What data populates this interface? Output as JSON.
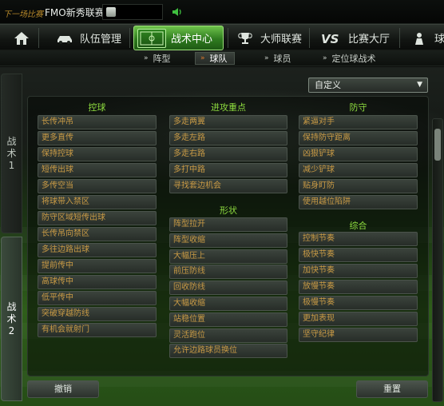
{
  "topbar": {
    "next_match": "下一场比赛",
    "league_name": "FMO新秀联赛"
  },
  "main_nav": [
    {
      "label": "",
      "icon": "home-icon"
    },
    {
      "label": "队伍管理",
      "icon": "car-icon"
    },
    {
      "label": "战术中心",
      "icon": "tactics-board-icon",
      "active": true
    },
    {
      "label": "大师联赛",
      "icon": "trophy-icon"
    },
    {
      "label": "比赛大厅",
      "icon": "vs-icon"
    },
    {
      "label": "球",
      "icon": "player-icon"
    }
  ],
  "sub_nav": [
    {
      "label": "阵型"
    },
    {
      "label": "球队",
      "active": true
    },
    {
      "label": "球员"
    },
    {
      "label": "定位球战术"
    }
  ],
  "tactic_tabs": [
    {
      "line1": "战",
      "line2": "术",
      "line3": "1"
    },
    {
      "line1": "战",
      "line2": "术",
      "line3": "2",
      "active": true
    }
  ],
  "mode_select": {
    "value": "自定义"
  },
  "columns": {
    "ball_control": {
      "title": "控球",
      "items": [
        "长传冲吊",
        "更多直传",
        "保持控球",
        "短传出球",
        "多传空当",
        "将球带入禁区",
        "防守区域短传出球",
        "长传吊向禁区",
        "多往边路出球",
        "提前传中",
        "高球传中",
        "低平传中",
        "突破穿越防线",
        "有机会就射门"
      ]
    },
    "attack_focus": {
      "title": "进攻重点",
      "items": [
        "多走两翼",
        "多走左路",
        "多走右路",
        "多打中路",
        "寻找套边机会"
      ]
    },
    "shape": {
      "title": "形状",
      "items": [
        "阵型拉开",
        "阵型收缩",
        "大幅压上",
        "前压防线",
        "回收防线",
        "大幅收缩",
        "站稳位置",
        "灵活跑位",
        "允许边路球员换位"
      ]
    },
    "defense": {
      "title": "防守",
      "items": [
        "紧逼对手",
        "保持防守距离",
        "凶狠铲球",
        "减少铲球",
        "贴身盯防",
        "使用越位陷阱"
      ]
    },
    "general": {
      "title": "综合",
      "items": [
        "控制节奏",
        "极快节奏",
        "加快节奏",
        "放慢节奏",
        "极慢节奏",
        "更加表现",
        "坚守纪律"
      ]
    }
  },
  "buttons": {
    "undo": "撤销",
    "reset": "重置"
  },
  "colors": {
    "accent_green": "#8edc3f",
    "option_text": "#c99a45",
    "active_tab": "#3c8f28",
    "sub_active_arrow": "#e07a2b"
  }
}
